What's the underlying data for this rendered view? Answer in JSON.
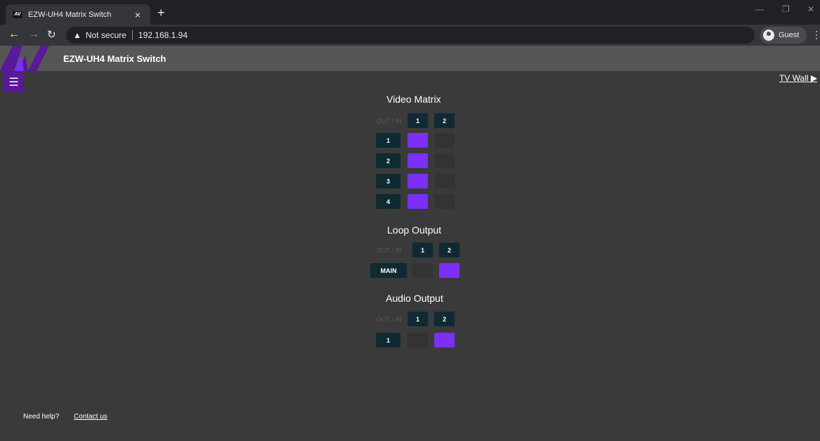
{
  "browser": {
    "tab_title": "EZW-UH4 Matrix Switch",
    "favicon_text": "AV",
    "close_glyph": "×",
    "new_tab_glyph": "+",
    "security_label": "Not secure",
    "url": "192.168.1.94",
    "profile_label": "Guest"
  },
  "header": {
    "title": "EZW-UH4 Matrix Switch",
    "logo_color": "#5a189a"
  },
  "nav": {
    "menu_glyph": "☰",
    "tv_wall_link": "TV Wall ▶"
  },
  "video_matrix": {
    "title": "Video Matrix",
    "header_label": "OUT / IN",
    "inputs": [
      "1",
      "2"
    ],
    "outputs": [
      "1",
      "2",
      "3",
      "4"
    ],
    "selected_input_per_output": [
      1,
      1,
      1,
      1
    ]
  },
  "loop_output": {
    "title": "Loop Output",
    "header_label": "OUT / IN",
    "inputs": [
      "1",
      "2"
    ],
    "outputs": [
      "MAIN"
    ],
    "selected_input_per_output": [
      2
    ]
  },
  "audio_output": {
    "title": "Audio Output",
    "header_label": "OUT / IN",
    "inputs": [
      "1",
      "2"
    ],
    "outputs": [
      "1"
    ],
    "selected_input_per_output": [
      2
    ]
  },
  "footer": {
    "help_text": "Need help?",
    "contact_link": "Contact us"
  },
  "colors": {
    "selected": "#7b2ff7",
    "unselected": "#333333",
    "button": "#0f2a33",
    "accent": "#5a189a"
  }
}
